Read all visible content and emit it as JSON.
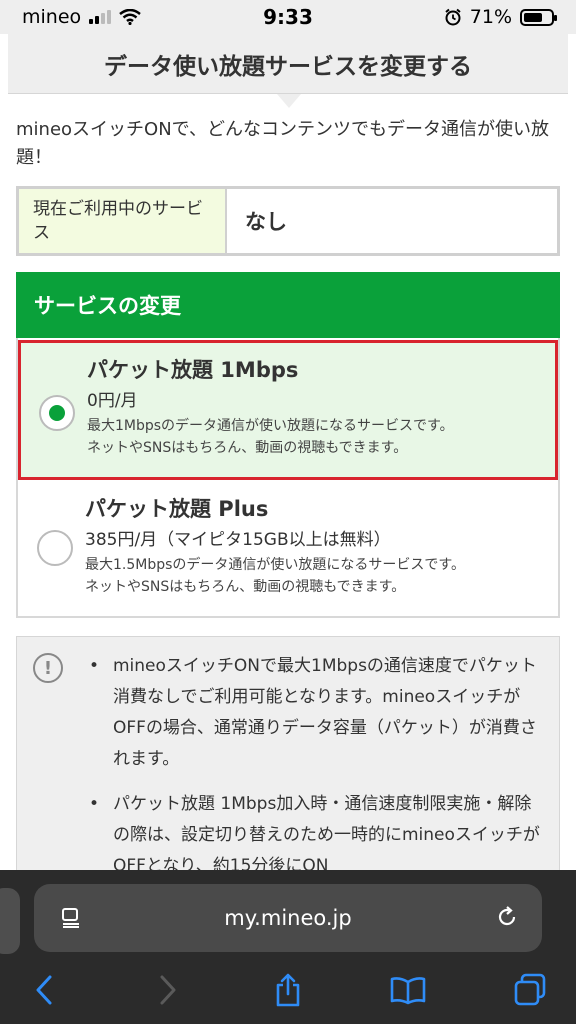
{
  "status_bar": {
    "carrier": "mineo",
    "time": "9:33",
    "battery_percent": "71%",
    "battery_level": 0.71
  },
  "page": {
    "title": "データ使い放題サービスを変更する",
    "intro": "mineoスイッチONで、どんなコンテンツでもデータ通信が使い放題！"
  },
  "current_service": {
    "label": "現在ご利用中のサービス",
    "value": "なし"
  },
  "change_section": {
    "heading": "サービスの変更",
    "options": [
      {
        "title": "パケット放題 1Mbps",
        "price": "0円/月",
        "desc_line1": "最大1Mbpsのデータ通信が使い放題になるサービスです。",
        "desc_line2": "ネットやSNSはもちろん、動画の視聴もできます。",
        "selected": true
      },
      {
        "title": "パケット放題 Plus",
        "price": "385円/月（マイピタ15GB以上は無料）",
        "desc_line1": "最大1.5Mbpsのデータ通信が使い放題になるサービスです。",
        "desc_line2": "ネットやSNSはもちろん、動画の視聴もできます。",
        "selected": false
      }
    ]
  },
  "notice": {
    "icon": "!",
    "items": [
      "mineoスイッチONで最大1Mbpsの通信速度でパケット消費なしでご利用可能となります。mineoスイッチがOFFの場合、通常通りデータ容量（パケット）が消費されます。",
      "パケット放題 1Mbps加入時・通信速度制限実施・解除の際は、設定切り替えのため一時的にmineoスイッチがOFFとなり、約15分後にON"
    ]
  },
  "browser": {
    "url": "my.mineo.jp"
  },
  "colors": {
    "accent_green": "#0aa13a",
    "selected_bg": "#e8f7e6",
    "selected_border": "#d8242e",
    "label_bg": "#f3fbe0",
    "safari_blue": "#2f8cf7"
  },
  "icons": {
    "signal": "cellular-signal-icon",
    "wifi": "wifi-icon",
    "alarm": "alarm-clock-icon",
    "battery": "battery-icon",
    "notice": "exclamation-circle-icon",
    "reader": "reader-mode-icon",
    "reload": "reload-icon",
    "back": "chevron-left-icon",
    "forward": "chevron-right-icon",
    "share": "share-icon",
    "bookmarks": "book-icon",
    "tabs": "tabs-icon"
  }
}
